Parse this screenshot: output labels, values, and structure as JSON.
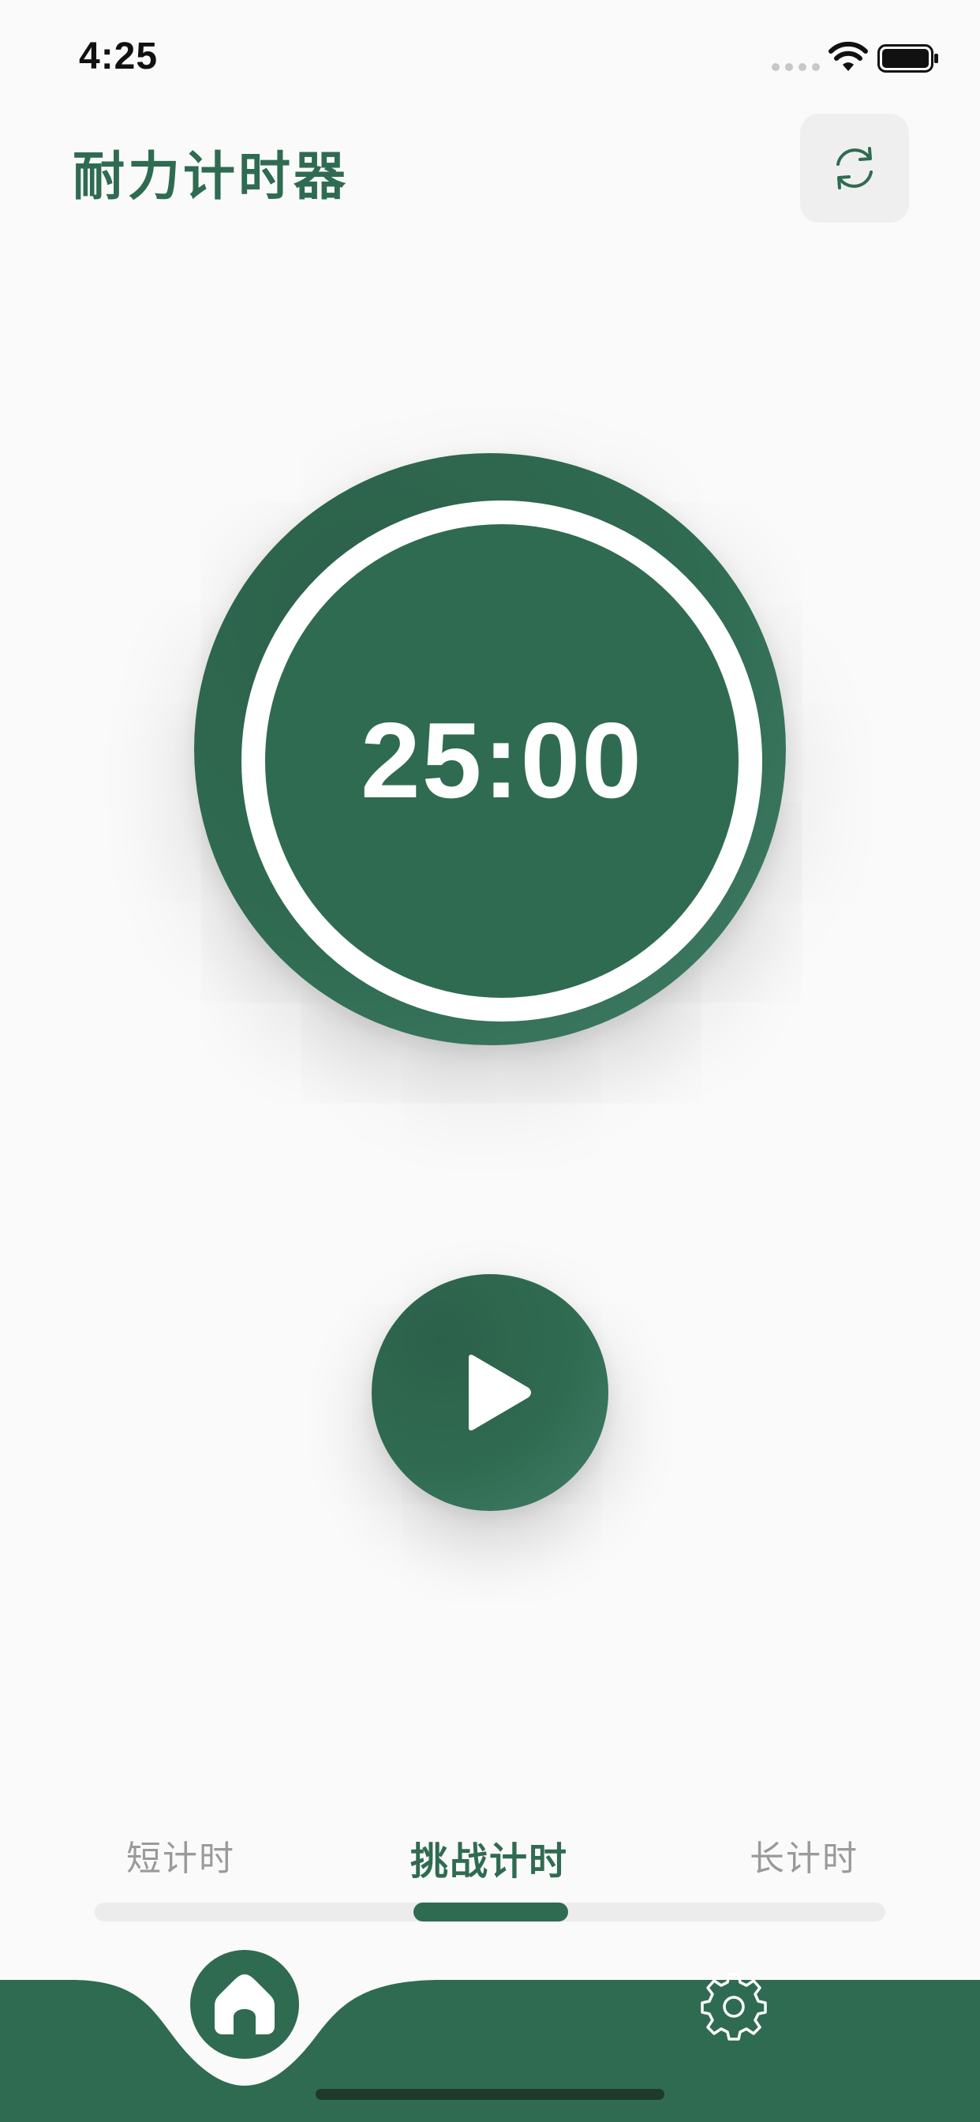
{
  "status_bar": {
    "time": "4:25"
  },
  "header": {
    "title": "耐力计时器",
    "refresh_icon": "refresh-icon"
  },
  "timer": {
    "display": "25:00"
  },
  "controls": {
    "play_icon": "play-icon"
  },
  "mode_tabs": {
    "items": [
      {
        "label": "短计时"
      },
      {
        "label": "挑战计时"
      },
      {
        "label": "长计时"
      }
    ],
    "active_index": 1
  },
  "bottom_nav": {
    "items": [
      {
        "icon": "home-icon"
      },
      {
        "icon": "gear-icon"
      }
    ],
    "active_index": 0
  },
  "colors": {
    "accent": "#2f6b51",
    "background": "#fafafa",
    "inactive_text": "#9a9a9a",
    "track": "#ececec"
  }
}
